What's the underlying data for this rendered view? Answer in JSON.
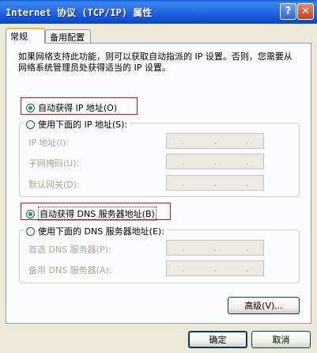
{
  "window": {
    "title": "Internet 协议 (TCP/IP) 属性",
    "help_glyph": "?",
    "close_glyph": "✕"
  },
  "tabs": [
    {
      "label": "常规",
      "active": true
    },
    {
      "label": "备用配置",
      "active": false
    }
  ],
  "description": "如果网络支持此功能，则可以获取自动指派的 IP 设置。否则，您需要从网络系统管理员处获得适当的 IP 设置。",
  "ip_section": {
    "auto_label": "自动获得 IP 地址(O)",
    "auto_checked": true,
    "manual_label": "使用下面的 IP 地址(S):",
    "manual_checked": false,
    "fields": [
      {
        "label": "IP 地址(I):"
      },
      {
        "label": "子网掩码(U):"
      },
      {
        "label": "默认网关(D):"
      }
    ]
  },
  "dns_section": {
    "auto_label": "自动获得 DNS 服务器地址(B)",
    "auto_checked": true,
    "manual_label": "使用下面的 DNS 服务器地址(E):",
    "manual_checked": false,
    "fields": [
      {
        "label": "首选 DNS 服务器(P):"
      },
      {
        "label": "备用 DNS 服务器(A):"
      }
    ]
  },
  "ip_dots": ".",
  "buttons": {
    "advanced": "高级(V)...",
    "ok": "确定",
    "cancel": "取消"
  },
  "colors": {
    "highlight_border": "#e01010",
    "titlebar": "#0d4fd0",
    "dialog_bg": "#ece9d8"
  }
}
